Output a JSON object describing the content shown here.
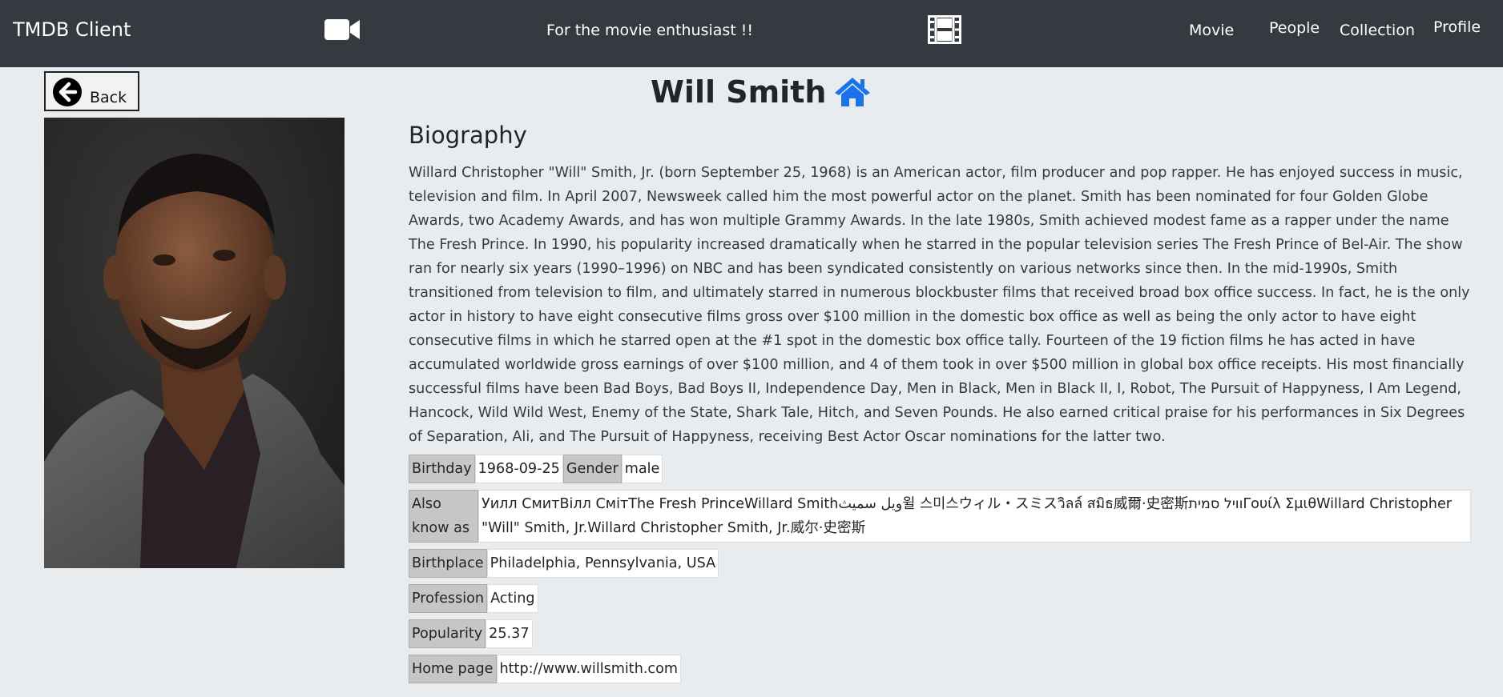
{
  "navbar": {
    "brand": "TMDB Client",
    "tagline": "For the movie enthusiast !!",
    "links": [
      "Movie",
      "People",
      "Collection",
      "Profile"
    ],
    "camera_icon": "video-camera-icon",
    "film_icon": "film-icon"
  },
  "back": {
    "label": "Back",
    "icon": "arrow-left-circle-icon"
  },
  "person": {
    "name": "Will Smith",
    "home_icon": "home-icon",
    "portrait": "photo of Will Smith",
    "biography_heading": "Biography",
    "biography": "Willard Christopher \"Will\" Smith, Jr. (born September 25, 1968) is an American actor, film producer and pop rapper. He has enjoyed success in music, television and film. In April 2007, Newsweek called him the most powerful actor on the planet. Smith has been nominated for four Golden Globe Awards, two Academy Awards, and has won multiple Grammy Awards. In the late 1980s, Smith achieved modest fame as a rapper under the name The Fresh Prince. In 1990, his popularity increased dramatically when he starred in the popular television series The Fresh Prince of Bel-Air. The show ran for nearly six years (1990–1996) on NBC and has been syndicated consistently on various networks since then. In the mid-1990s, Smith transitioned from television to film, and ultimately starred in numerous blockbuster films that received broad box office success. In fact, he is the only actor in history to have eight consecutive films gross over $100 million in the domestic box office as well as being the only actor to have eight consecutive films in which he starred open at the #1 spot in the domestic box office tally. Fourteen of the 19 fiction films he has acted in have accumulated worldwide gross earnings of over $100 million, and 4 of them took in over $500 million in global box office receipts. His most financially successful films have been Bad Boys, Bad Boys II, Independence Day, Men in Black, Men in Black II, I, Robot, The Pursuit of Happyness, I Am Legend, Hancock, Wild Wild West, Enemy of the State, Shark Tale, Hitch, and Seven Pounds. He also earned critical praise for his performances in Six Degrees of Separation, Ali, and The Pursuit of Happyness, receiving Best Actor Oscar nominations for the latter two."
  },
  "details": {
    "birthday_label": "Birthday",
    "birthday": "1968-09-25",
    "gender_label": "Gender",
    "gender": "male",
    "aka_label": "Also know as",
    "aka": "Уилл СмитВілл СмітThe Fresh PrinceWillard Smithويل سميث윌 스미스ウィル・スミスวิลล์ สมิธ威爾·史密斯וויל סמיתΓουίλ ΣμιθWillard Christopher \"Will\" Smith, Jr.Willard Christopher Smith, Jr.威尔·史密斯",
    "birthplace_label": "Birthplace",
    "birthplace": "Philadelphia, Pennsylvania, USA",
    "profession_label": "Profession",
    "profession": "Acting",
    "popularity_label": "Popularity",
    "popularity": "25.37",
    "homepage_label": "Home page",
    "homepage": "http://www.willsmith.com"
  }
}
